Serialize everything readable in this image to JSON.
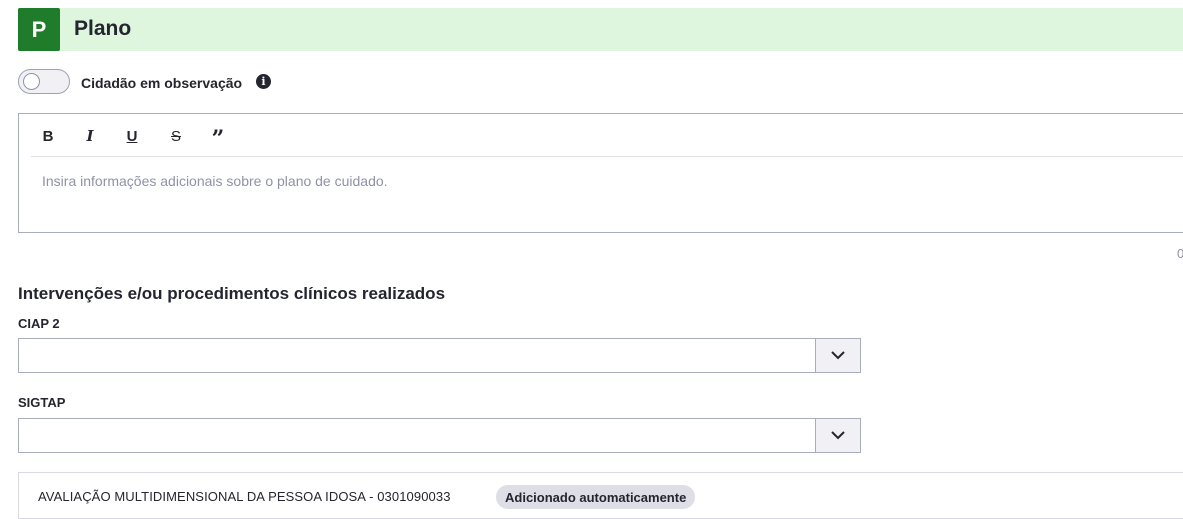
{
  "header": {
    "badge": "P",
    "title": "Plano",
    "accent_color": "#1e7c2a",
    "bar_color": "#def5de"
  },
  "observation": {
    "toggle_on": false,
    "label": "Cidadão em observação",
    "info_icon": "info-icon"
  },
  "editor": {
    "toolbar": [
      {
        "name": "bold",
        "glyph": "B"
      },
      {
        "name": "italic",
        "glyph": "I"
      },
      {
        "name": "underline",
        "glyph": "U"
      },
      {
        "name": "strikethrough",
        "glyph": "S"
      },
      {
        "name": "quote",
        "glyph": "”"
      }
    ],
    "placeholder": "Insira informações adicionais sobre o plano de cuidado.",
    "char_count": "0"
  },
  "interventions": {
    "title": "Intervenções e/ou procedimentos clínicos realizados",
    "ciap_label": "CIAP 2",
    "ciap_value": "",
    "sigtap_label": "SIGTAP",
    "sigtap_value": "",
    "procedure": {
      "text": "AVALIAÇÃO MULTIDIMENSIONAL DA PESSOA IDOSA - 0301090033",
      "badge": "Adicionado automaticamente"
    }
  }
}
